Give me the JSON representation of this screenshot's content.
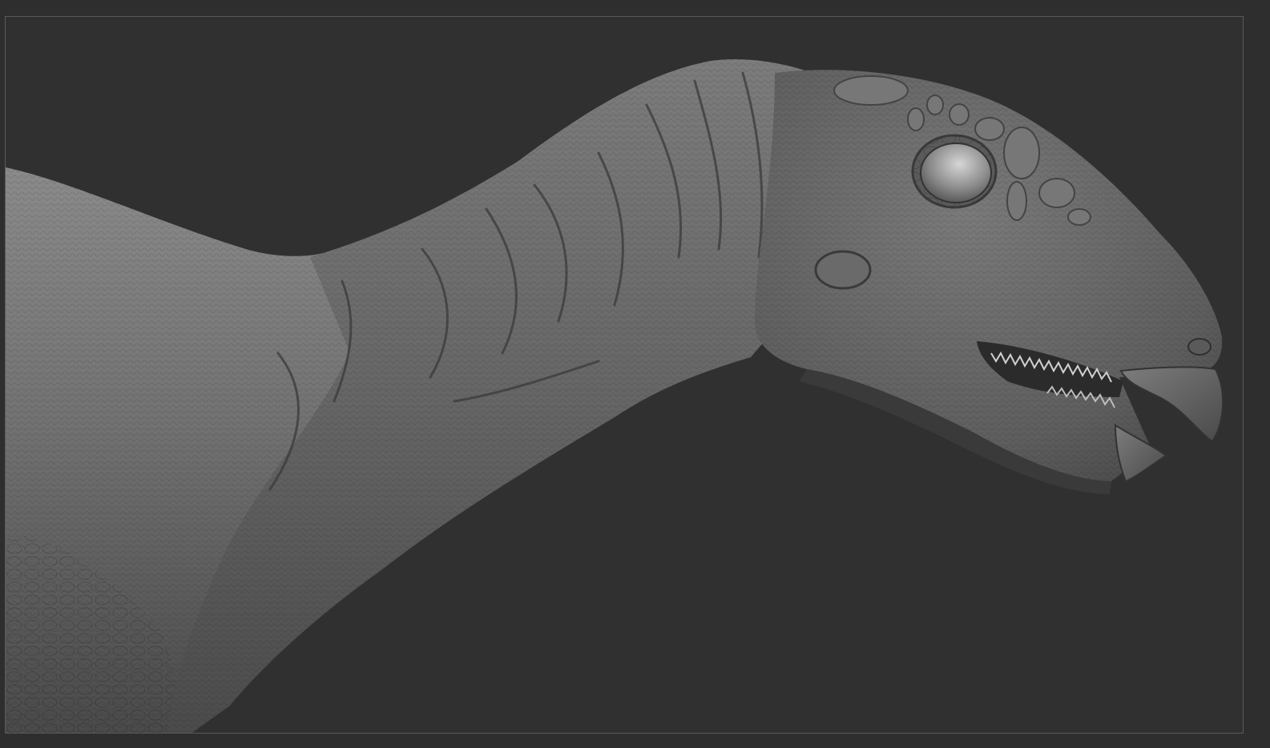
{
  "viewport": {
    "object": "dinosaur-head-and-neck-sculpt",
    "render_mode": "matcap-gray",
    "background_color": "#303030",
    "frame_color": "#5a5a5a",
    "model_color": "#6f6f6f"
  }
}
